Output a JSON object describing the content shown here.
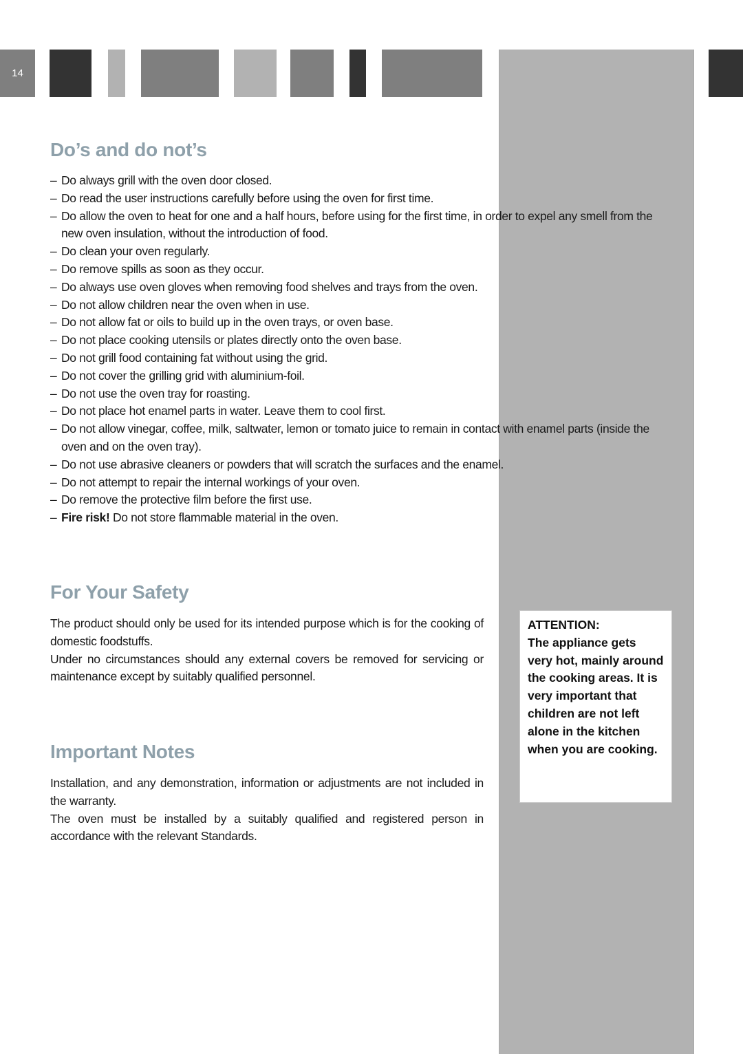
{
  "page_number": "14",
  "header_blocks": [
    {
      "shade": "mid"
    },
    {
      "shade": "dark"
    },
    {
      "shade": "light"
    },
    {
      "shade": "mid"
    },
    {
      "shade": "light"
    },
    {
      "shade": "mid"
    },
    {
      "shade": "dark"
    },
    {
      "shade": "mid"
    },
    {
      "shade": "dark"
    }
  ],
  "colors": {
    "heading": "#8ea0aa",
    "block_dark": "#333333",
    "block_mid": "#7f7f7f",
    "block_light": "#b2b2b2",
    "side_column": "#b2b2b2"
  },
  "dos_section": {
    "title": "Do’s and do not’s",
    "items": [
      {
        "bold": "",
        "text": "Do always grill with the oven door closed."
      },
      {
        "bold": "",
        "text": "Do read the user instructions carefully before using the oven for first time."
      },
      {
        "bold": "",
        "text": "Do allow the oven to heat for one and a half hours, before using for the first time, in order to expel any smell from the new oven insulation, without the introduction of food."
      },
      {
        "bold": "",
        "text": "Do clean your oven regularly."
      },
      {
        "bold": "",
        "text": "Do remove spills as soon as they occur."
      },
      {
        "bold": "",
        "text": "Do always use oven gloves when removing food shelves and trays from the oven."
      },
      {
        "bold": "",
        "text": "Do not allow children near the oven when in use."
      },
      {
        "bold": "",
        "text": "Do not allow fat or oils to build up in the oven trays, or oven base."
      },
      {
        "bold": "",
        "text": "Do not place cooking utensils or plates directly onto the oven base."
      },
      {
        "bold": "",
        "text": "Do not grill food containing fat without using the grid."
      },
      {
        "bold": "",
        "text": "Do not cover the grilling grid with aluminium-foil."
      },
      {
        "bold": "",
        "text": "Do not use the oven tray for roasting."
      },
      {
        "bold": "",
        "text": "Do not place hot enamel parts in water. Leave them to cool first."
      },
      {
        "bold": "",
        "text": "Do not allow vinegar, coffee, milk, saltwater, lemon or tomato juice to remain in contact with enamel parts (inside the oven and on the oven tray)."
      },
      {
        "bold": "",
        "text": "Do not use abrasive cleaners or powders that will scratch the surfaces and the enamel."
      },
      {
        "bold": "",
        "text": "Do not attempt to repair the internal workings of your oven."
      },
      {
        "bold": "",
        "text": "Do remove the protective film before the first use."
      },
      {
        "bold": "Fire risk!",
        "text": " Do not store flammable material in the oven."
      }
    ]
  },
  "safety_section": {
    "title": "For Your Safety",
    "paragraphs": [
      "The product should only be used for its intended purpose which is for the cooking of domestic foodstuffs.",
      "Under no circumstances should any external covers be removed for servicing or maintenance except by suitably qualified personnel."
    ]
  },
  "notes_section": {
    "title": "Important Notes",
    "paragraphs": [
      "Installation, and any demonstration, information or adjustments are not included in the warranty.",
      "The oven must be installed by a suitably qualified and registered person in accordance with the relevant Standards."
    ]
  },
  "attention_box": {
    "label": "ATTENTION:",
    "text": "The appliance gets very hot, mainly around the cooking areas. It is very important that children are not left alone in the kitchen when you are cooking."
  }
}
